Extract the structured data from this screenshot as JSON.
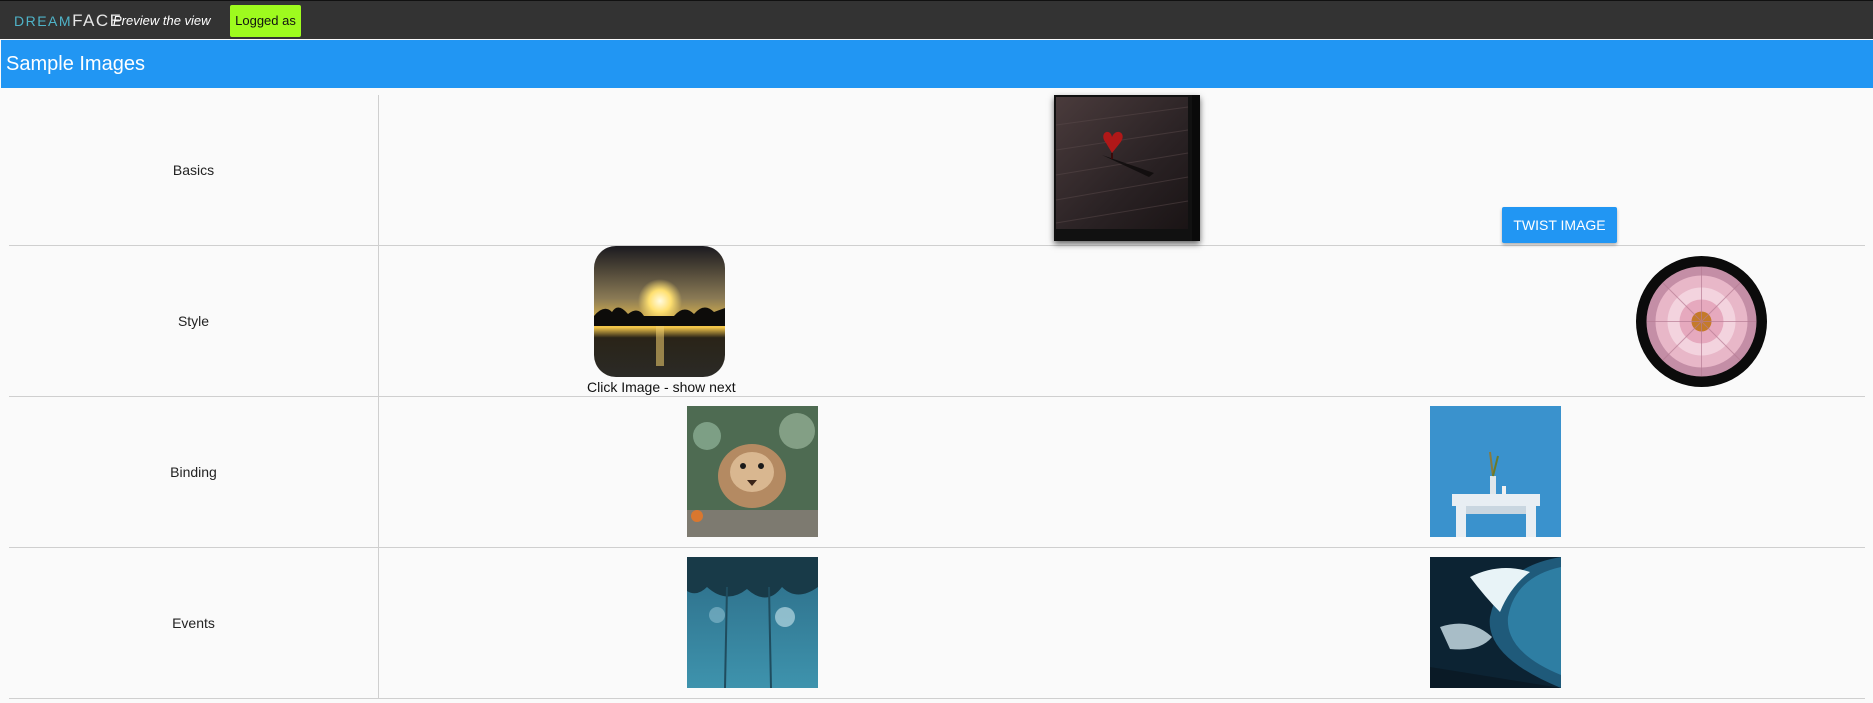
{
  "header": {
    "logo_left": "DREAM",
    "logo_right": "FACE",
    "preview_label": "Preview the view",
    "logged_label": "Logged as"
  },
  "title": "Sample Images",
  "rows": [
    {
      "label": "Basics"
    },
    {
      "label": "Style"
    },
    {
      "label": "Binding"
    },
    {
      "label": "Events"
    }
  ],
  "style_row": {
    "caption": "Click Image - show next",
    "button_label": "TWIST IMAGE"
  },
  "colors": {
    "topbar": "#333333",
    "title_bar": "#2196f3",
    "button": "#2196f3",
    "logged_badge": "#9efb1e"
  }
}
